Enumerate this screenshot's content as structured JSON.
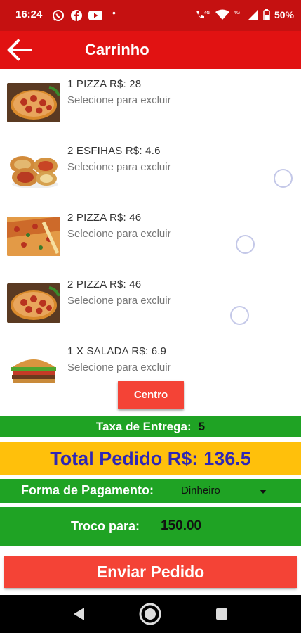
{
  "status_bar": {
    "time": "16:24",
    "dot": "•",
    "battery": "50%",
    "net_label": "4G",
    "net_label_2": "4G"
  },
  "header": {
    "title": "Carrinho",
    "back_icon": "arrow-left-icon"
  },
  "cart": {
    "items": [
      {
        "title": "1 PIZZA R$: 28",
        "subtitle": "Selecione para excluir",
        "image": "pizza",
        "radio_visible": false
      },
      {
        "title": "2 ESFIHAS R$: 4.6",
        "subtitle": "Selecione para excluir",
        "image": "esfihas",
        "radio_visible": true
      },
      {
        "title": "2 PIZZA R$: 46",
        "subtitle": "Selecione para excluir",
        "image": "pizza-slice",
        "radio_visible": true
      },
      {
        "title": "2 PIZZA R$: 46",
        "subtitle": "Selecione para excluir",
        "image": "pizza",
        "radio_visible": true
      },
      {
        "title": "1 X SALADA R$: 6.9",
        "subtitle": "Selecione para excluir",
        "image": "burger",
        "radio_visible": false
      }
    ]
  },
  "centro_button": "Centro",
  "delivery": {
    "label": "Taxa de Entrega:",
    "value": "5"
  },
  "total": {
    "label": "Total Pedido R$:",
    "value": "136.5"
  },
  "payment": {
    "label": "Forma de Pagamento:",
    "selected": "Dinheiro"
  },
  "change": {
    "label": "Troco para:",
    "value": "150.00"
  },
  "submit_button": "Enviar Pedido",
  "colors": {
    "status_bar": "#c51111",
    "app_bar": "#e11212",
    "button_red": "#f44336",
    "green": "#1fa324",
    "yellow": "#ffc00b",
    "total_text": "#2f27b5"
  },
  "nav": {
    "back_icon": "nav-back-icon",
    "home_icon": "nav-home-icon",
    "recents_icon": "nav-recents-icon"
  }
}
